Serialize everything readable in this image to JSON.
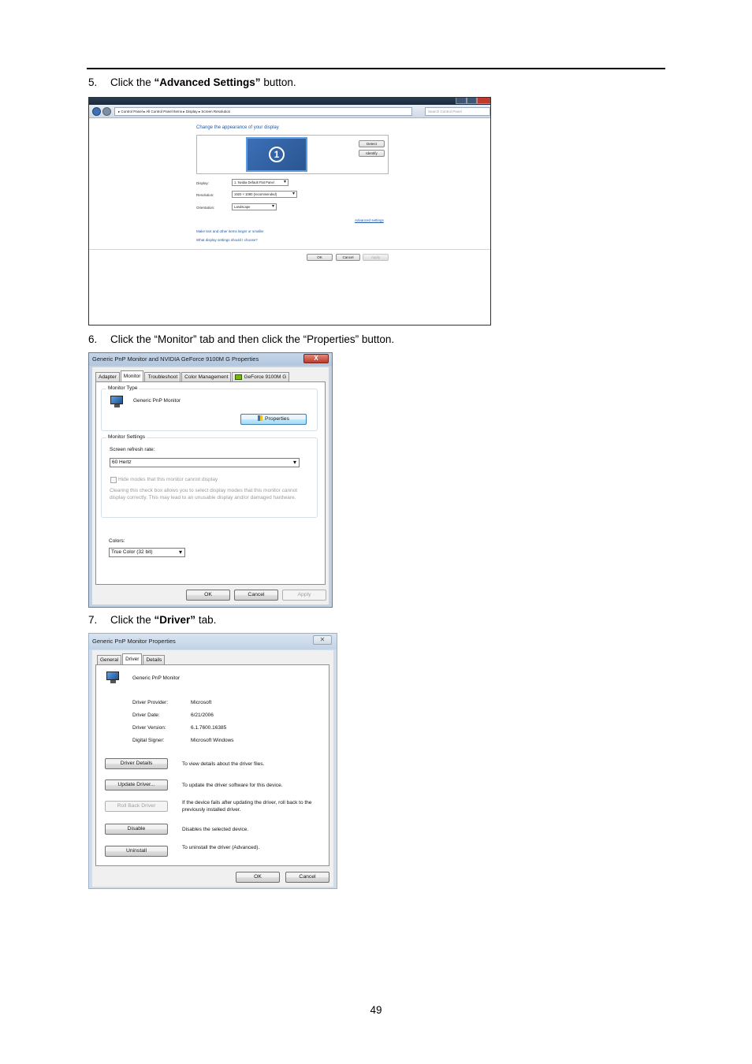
{
  "page_number": "49",
  "steps": [
    {
      "num": "5.",
      "pre": "Click the ",
      "bold": "“Advanced Settings”",
      "post": " button."
    },
    {
      "num": "6.",
      "text": "Click the “Monitor” tab and then click the “Properties” button."
    },
    {
      "num": "7.",
      "pre": "Click the ",
      "bold": "“Driver”",
      "post": " tab."
    }
  ],
  "screen_resolution": {
    "breadcrumb": "▸ Control Panel ▸ All Control Panel Items ▸ Display ▸ Screen Resolution",
    "search_placeholder": "Search Control Panel",
    "heading": "Change the appearance of your display",
    "monitor_number": "1",
    "detect_label": "Detect",
    "identify_label": "Identify",
    "display_label": "Display:",
    "display_value": "1. Nvidia Default Flat Panel",
    "resolution_label": "Resolution:",
    "resolution_value": "1920 × 1080 (recommended)",
    "orientation_label": "Orientation:",
    "orientation_value": "Landscape",
    "advanced_link": "Advanced settings",
    "link_text_size": "Make text and other items larger or smaller",
    "link_display_settings": "What display settings should I choose?",
    "ok_label": "OK",
    "cancel_label": "Cancel",
    "apply_label": "Apply"
  },
  "monitor_properties": {
    "title": "Generic PnP Monitor and NVIDIA GeForce 9100M G   Properties",
    "close_glyph": "X",
    "tabs": [
      "Adapter",
      "Monitor",
      "Troubleshoot",
      "Color Management",
      "GeForce 9100M G"
    ],
    "monitor_type_label": "Monitor Type",
    "monitor_name": "Generic PnP Monitor",
    "properties_label": "Properties",
    "monitor_settings_label": "Monitor Settings",
    "refresh_label": "Screen refresh rate:",
    "refresh_value": "60 Hertz",
    "hide_modes_label": "Hide modes that this monitor cannot display",
    "hide_modes_note": "Clearing this check box allows you to select display modes that this monitor cannot display correctly. This may lead to an unusable display and/or damaged hardware.",
    "colors_label": "Colors:",
    "colors_value": "True Color (32 bit)",
    "ok_label": "OK",
    "cancel_label": "Cancel",
    "apply_label": "Apply"
  },
  "driver_properties": {
    "title": "Generic PnP Monitor Properties",
    "close_glyph": "✕",
    "tabs": [
      "General",
      "Driver",
      "Details"
    ],
    "device_name": "Generic PnP Monitor",
    "info": [
      {
        "label": "Driver Provider:",
        "value": "Microsoft"
      },
      {
        "label": "Driver Date:",
        "value": "6/21/2006"
      },
      {
        "label": "Driver Version:",
        "value": "6.1.7600.16385"
      },
      {
        "label": "Digital Signer:",
        "value": "Microsoft Windows"
      }
    ],
    "actions": [
      {
        "button": "Driver Details",
        "desc": "To view details about the driver files.",
        "disabled": false
      },
      {
        "button": "Update Driver...",
        "desc": "To update the driver software for this device.",
        "disabled": false
      },
      {
        "button": "Roll Back Driver",
        "desc": "If the device fails after updating the driver, roll back to the previously installed driver.",
        "disabled": true
      },
      {
        "button": "Disable",
        "desc": "Disables the selected device.",
        "disabled": false
      },
      {
        "button": "Uninstall",
        "desc": "To uninstall the driver (Advanced).",
        "disabled": false
      }
    ],
    "ok_label": "OK",
    "cancel_label": "Cancel"
  }
}
